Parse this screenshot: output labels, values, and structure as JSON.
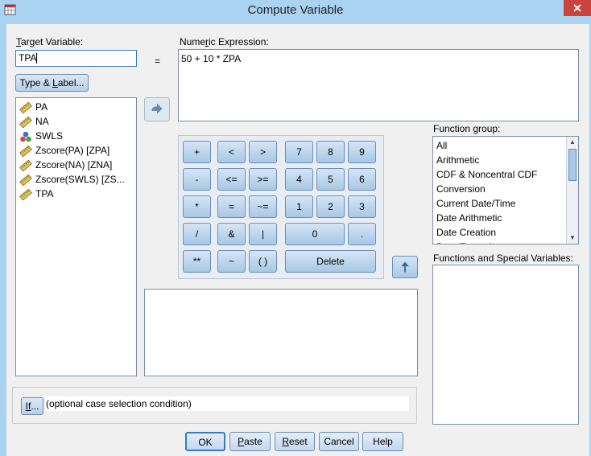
{
  "window": {
    "title": "Compute Variable",
    "close_glyph": "✕"
  },
  "target": {
    "label": "Target Variable:",
    "label_underline": "T",
    "label_rest": "arget Variable:",
    "value": "TPA",
    "equals": "="
  },
  "type_label_button": {
    "pre": "Type & ",
    "ul": "L",
    "post": "abel..."
  },
  "variables": [
    {
      "name": "PA",
      "icon": "ruler-icon"
    },
    {
      "name": "NA",
      "icon": "ruler-icon"
    },
    {
      "name": "SWLS",
      "icon": "nominal-balls-icon"
    },
    {
      "name": "Zscore(PA) [ZPA]",
      "icon": "ruler-icon"
    },
    {
      "name": "Zscore(NA) [ZNA]",
      "icon": "ruler-icon"
    },
    {
      "name": "Zscore(SWLS) [ZS...",
      "icon": "ruler-icon"
    },
    {
      "name": "TPA",
      "icon": "ruler-icon"
    }
  ],
  "expression": {
    "label_pre": "Nume",
    "label_ul": "r",
    "label_post": "ic Expression:",
    "value": "50 + 10 * ZPA"
  },
  "keypad": {
    "ops": [
      [
        "+",
        "<",
        ">"
      ],
      [
        "-",
        "<=",
        ">="
      ],
      [
        "*",
        "=",
        "~="
      ],
      [
        "/",
        "&",
        "|"
      ],
      [
        "**",
        "~",
        "( )"
      ]
    ],
    "digits": [
      [
        "7",
        "8",
        "9"
      ],
      [
        "4",
        "5",
        "6"
      ],
      [
        "1",
        "2",
        "3"
      ]
    ],
    "zero": "0",
    "dot": ".",
    "delete": "Delete"
  },
  "function_group": {
    "label": "Function group:",
    "items": [
      "All",
      "Arithmetic",
      "CDF & Noncentral CDF",
      "Conversion",
      "Current Date/Time",
      "Date Arithmetic",
      "Date Creation",
      "Date Extraction"
    ]
  },
  "functions": {
    "label": "Functions and Special Variables:"
  },
  "if": {
    "button_ul": "If",
    "button_rest": "...",
    "text": "(optional case selection condition)"
  },
  "buttons": {
    "ok": "OK",
    "paste_ul": "P",
    "paste_rest": "aste",
    "reset_ul": "R",
    "reset_rest": "eset",
    "cancel": "Cancel",
    "help": "Help"
  }
}
